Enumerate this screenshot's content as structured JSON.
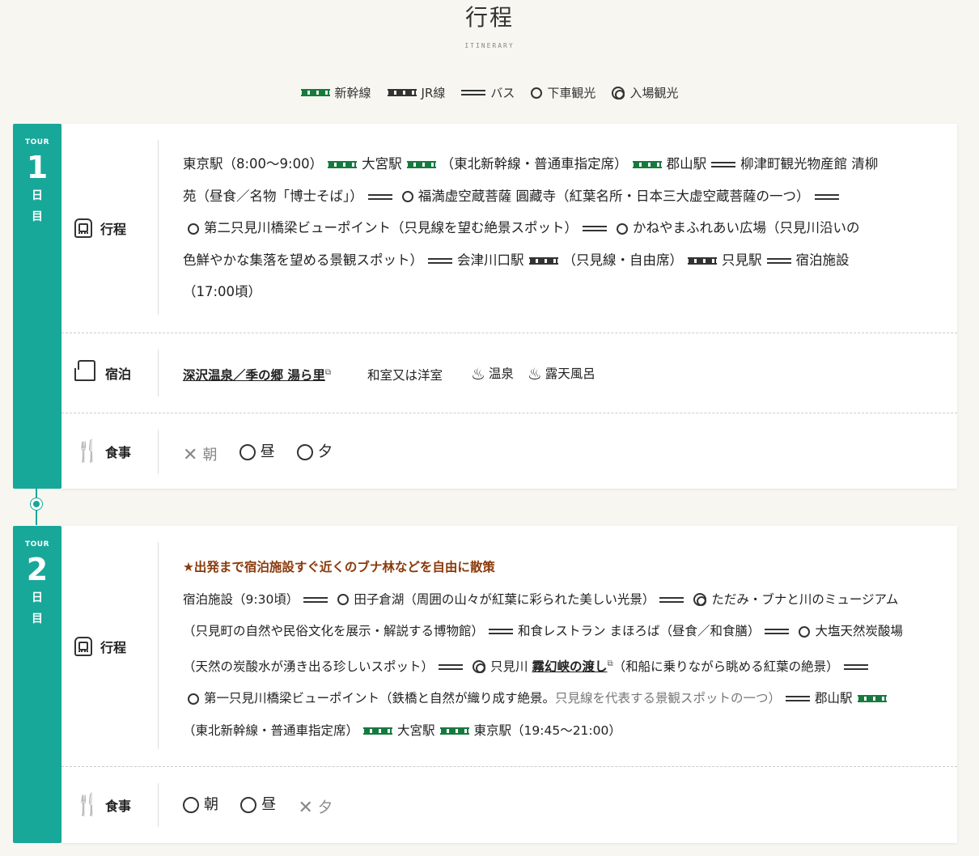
{
  "header": {
    "title": "行程",
    "subtitle": "ITINERARY"
  },
  "legend": [
    {
      "icon": "shinkansen-rail-icon",
      "label": "新幹線"
    },
    {
      "icon": "jr-rail-icon",
      "label": "JR線"
    },
    {
      "icon": "bus-line-icon",
      "label": "バス"
    },
    {
      "icon": "circle-icon",
      "label": "下車観光"
    },
    {
      "icon": "double-circle-icon",
      "label": "入場観光"
    }
  ],
  "colors": {
    "accent": "#17a89a",
    "shinkansen": "#167a3f",
    "note": "#8a3a0b"
  },
  "day1": {
    "tour": "TOUR",
    "num": "1",
    "unit1": "日",
    "unit2": "目",
    "itinerary_label": "行程",
    "s": [
      "東京駅（8:00～9:00）",
      "大宮駅",
      "（東北新幹線・普通車指定席）",
      "郡山駅",
      "柳津町観光物産館 清柳",
      "苑（昼食／名物「博士そば」）",
      "福満虚空蔵菩薩 圓藏寺（紅葉名所・日本三大虚空蔵菩薩の一つ）",
      "第二只見川橋梁ビューポイント（只見線を望む絶景スポット）",
      "かねやまふれあい広場（只見川沿いの",
      "色鮮やかな集落を望める景観スポット）",
      "会津川口駅",
      "（只見線・自由席）",
      "只見駅",
      "宿泊施設",
      "（17:00頃）"
    ],
    "stay_label": "宿泊",
    "hotel": "深沢温泉／季の郷 湯ら里",
    "room": "和室又は洋室",
    "onsen": "温泉",
    "rotenburo": "露天風呂",
    "meal_label": "食事",
    "meals": {
      "breakfast": "朝",
      "lunch": "昼",
      "dinner": "夕"
    }
  },
  "day2": {
    "tour": "TOUR",
    "num": "2",
    "unit1": "日",
    "unit2": "目",
    "itinerary_label": "行程",
    "note": "★出発まで宿泊施設すぐ近くのブナ林などを自由に散策",
    "s": [
      "宿泊施設（9:30頃）",
      "田子倉湖（周囲の山々が紅葉に彩られた美しい光景）",
      "ただみ・ブナと川のミュージアム",
      "（只見町の自然や民俗文化を展示・解説する博物館）",
      "和食レストラン まほろば（昼食／和食膳）",
      "大塩天然炭酸場",
      "（天然の炭酸水が湧き出る珍しいスポット）",
      "只見川 ",
      "霧幻峡の渡し",
      "（和船に乗りながら眺める紅葉の絶景）",
      "第一只見川橋梁ビューポイント（鉄橋と自然が織り成す絶景。",
      "只見線を代表する景観スポットの一つ）",
      "郡山駅",
      "（東北新幹線・普通車指定席）",
      "大宮駅",
      "東京駅（19:45～21:00）"
    ],
    "meal_label": "食事",
    "meals": {
      "breakfast": "朝",
      "lunch": "昼",
      "dinner": "夕"
    }
  }
}
